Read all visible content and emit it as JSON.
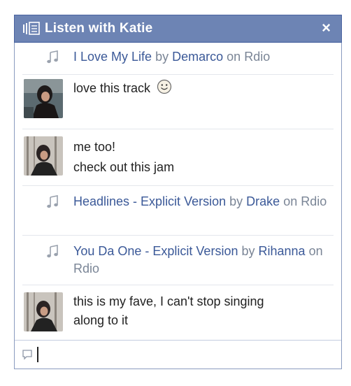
{
  "chat": {
    "title": "Listen with Katie",
    "close_label": "×",
    "colors": {
      "titlebar": "#6d84b4",
      "link": "#3b5998"
    }
  },
  "rows": [
    {
      "type": "track",
      "song": "I Love My Life",
      "by": "by",
      "artist": "Demarco",
      "on": "on",
      "service": "Rdio"
    },
    {
      "type": "message",
      "lines": [
        "love this track"
      ],
      "emoji": "smiley-icon"
    },
    {
      "type": "message",
      "lines": [
        "me too!",
        "check out this jam"
      ]
    },
    {
      "type": "track",
      "song": "Headlines - Explicit Version",
      "by": "by",
      "artist": "Drake",
      "on": "on",
      "service": "Rdio"
    },
    {
      "type": "track",
      "song": "You Da One - Explicit Version",
      "by": "by",
      "artist": "Rihanna",
      "on": "on",
      "service": "Rdio"
    },
    {
      "type": "message",
      "lines": [
        "this is my fave, I can't stop singing",
        "along to it"
      ]
    }
  ],
  "composer": {
    "value": "",
    "placeholder": ""
  }
}
